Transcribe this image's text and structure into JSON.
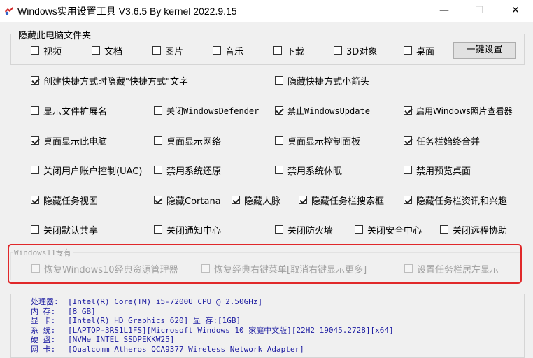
{
  "window": {
    "title": "Windows实用设置工具 V3.6.5 By kernel 2022.9.15",
    "minimize": "—",
    "maximize": "☐",
    "close": "✕"
  },
  "hide_folders": {
    "legend": "隐藏此电脑文件夹",
    "items": [
      {
        "label": "视频",
        "checked": false
      },
      {
        "label": "文档",
        "checked": false
      },
      {
        "label": "图片",
        "checked": false
      },
      {
        "label": "音乐",
        "checked": false
      },
      {
        "label": "下载",
        "checked": false
      },
      {
        "label": "3D对象",
        "checked": false
      },
      {
        "label": "桌面",
        "checked": false
      }
    ],
    "one_click_button": "一键设置"
  },
  "options": [
    {
      "label": "创建快捷方式时隐藏\"快捷方式\"文字",
      "checked": true
    },
    {
      "label": "隐藏快捷方式小箭头",
      "checked": false
    },
    {
      "label": "显示文件扩展名",
      "checked": false
    },
    {
      "label": "关闭WindowsDefender",
      "checked": false
    },
    {
      "label": "禁止WindowsUpdate",
      "checked": true
    },
    {
      "label": "启用Windows照片查看器",
      "checked": true
    },
    {
      "label": "桌面显示此电脑",
      "checked": true
    },
    {
      "label": "桌面显示网络",
      "checked": false
    },
    {
      "label": "桌面显示控制面板",
      "checked": false
    },
    {
      "label": "任务栏始终合并",
      "checked": true
    },
    {
      "label": "关闭用户账户控制(UAC)",
      "checked": false
    },
    {
      "label": "禁用系统还原",
      "checked": false
    },
    {
      "label": "禁用系统休眠",
      "checked": false
    },
    {
      "label": "禁用预览桌面",
      "checked": false
    },
    {
      "label": "隐藏任务视图",
      "checked": true
    },
    {
      "label": "隐藏Cortana",
      "checked": true
    },
    {
      "label": "隐藏人脉",
      "checked": true
    },
    {
      "label": "隐藏任务栏搜索框",
      "checked": true
    },
    {
      "label": "隐藏任务栏资讯和兴趣",
      "checked": true
    },
    {
      "label": "关闭默认共享",
      "checked": false
    },
    {
      "label": "关闭通知中心",
      "checked": false
    },
    {
      "label": "关闭防火墙",
      "checked": false
    },
    {
      "label": "关闭安全中心",
      "checked": false
    },
    {
      "label": "关闭远程协助",
      "checked": false
    }
  ],
  "win11": {
    "legend": "Windows11专有",
    "items": [
      {
        "label": "恢复Windows10经典资源管理器",
        "checked": false
      },
      {
        "label": "恢复经典右键菜单[取消右键显示更多]",
        "checked": false
      },
      {
        "label": "设置任务栏居左显示",
        "checked": false
      }
    ]
  },
  "system_info": [
    {
      "label": "处理器:",
      "value": "[Intel(R) Core(TM) i5-7200U CPU @ 2.50GHz]"
    },
    {
      "label": "内  存:",
      "value": "[8 GB]"
    },
    {
      "label": "显  卡:",
      "value": "[Intel(R) HD Graphics 620]  显 存:[1GB]"
    },
    {
      "label": "系  统:",
      "value": "[LAPTOP-3RS1L1FS][Microsoft Windows 10 家庭中文版][22H2 19045.2728][x64]"
    },
    {
      "label": "硬  盘:",
      "value": "[NVMe INTEL SSDPEKKW25]"
    },
    {
      "label": "网  卡:",
      "value": "[Qualcomm Atheros QCA9377 Wireless Network Adapter]"
    }
  ],
  "colors": {
    "highlight": "#e0282a",
    "info_text": "#1a1aa0"
  }
}
